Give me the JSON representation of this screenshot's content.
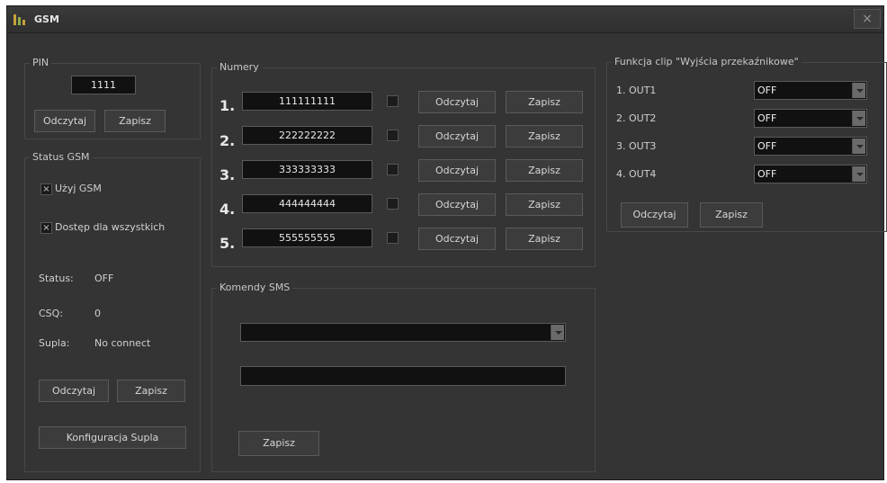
{
  "window": {
    "title": "GSM",
    "close_label": "×"
  },
  "pin": {
    "label": "PIN",
    "value": "1111",
    "read_label": "Odczytaj",
    "save_label": "Zapisz"
  },
  "status_gsm": {
    "label": "Status GSM",
    "use_gsm": {
      "label": "Użyj GSM",
      "checked": true,
      "mark": "×"
    },
    "access_all": {
      "label": "Dostęp dla wszystkich",
      "checked": true,
      "mark": "×"
    },
    "status": {
      "key": "Status:",
      "value": "OFF"
    },
    "csq": {
      "key": "CSQ:",
      "value": "0"
    },
    "supla": {
      "key": "Supla:",
      "value": "No connect"
    },
    "read_label": "Odczytaj",
    "save_label": "Zapisz",
    "config_label": "Konfiguracja Supla"
  },
  "numbers": {
    "label": "Numery",
    "rows": [
      {
        "index": "1.",
        "value": "111111111",
        "read_label": "Odczytaj",
        "save_label": "Zapisz"
      },
      {
        "index": "2.",
        "value": "222222222",
        "read_label": "Odczytaj",
        "save_label": "Zapisz"
      },
      {
        "index": "3.",
        "value": "333333333",
        "read_label": "Odczytaj",
        "save_label": "Zapisz"
      },
      {
        "index": "4.",
        "value": "444444444",
        "read_label": "Odczytaj",
        "save_label": "Zapisz"
      },
      {
        "index": "5.",
        "value": "555555555",
        "read_label": "Odczytaj",
        "save_label": "Zapisz"
      }
    ]
  },
  "sms": {
    "label": "Komendy SMS",
    "command_select": "",
    "command_text": "",
    "save_label": "Zapisz"
  },
  "clip": {
    "label": "Funkcja clip \"Wyjścia przekaźnikowe\"",
    "outputs": [
      {
        "label": "1. OUT1",
        "value": "OFF"
      },
      {
        "label": "2. OUT2",
        "value": "OFF"
      },
      {
        "label": "3. OUT3",
        "value": "OFF"
      },
      {
        "label": "4. OUT4",
        "value": "OFF"
      }
    ],
    "read_label": "Odczytaj",
    "save_label": "Zapisz"
  },
  "colors": {
    "background": "#343434",
    "field": "#111111",
    "border": "#5a5a5a",
    "app_icon": "#c8a13a"
  },
  "icons": {
    "app": "gsm-app-icon",
    "close": "close-icon"
  }
}
